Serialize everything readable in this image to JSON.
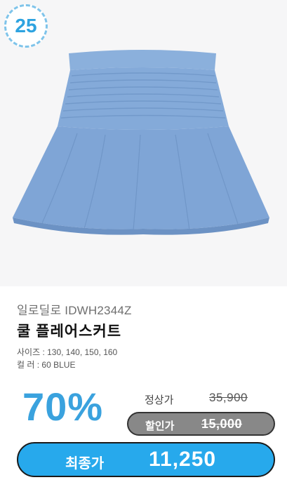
{
  "badge": {
    "number": "25"
  },
  "product": {
    "image_label": "blue-flare-skirt-photo",
    "brand_code": "일로딜로 IDWH2344Z",
    "name": "쿨 플레어스커트",
    "sizes": "사이즈 : 130, 140, 150, 160",
    "color": "컬     러 : 60 BLUE"
  },
  "pricing": {
    "discount": "70%",
    "regular_label": "정상가",
    "regular_price": "35,900",
    "sale_label": "할인가",
    "sale_price": "15,000",
    "final_label": "최종가",
    "final_price": "11,250"
  },
  "colors": {
    "accent": "#27a9ec",
    "discount_text": "#3aa2de",
    "skirt": "#7fa7d6",
    "sale_pill": "#888888"
  }
}
